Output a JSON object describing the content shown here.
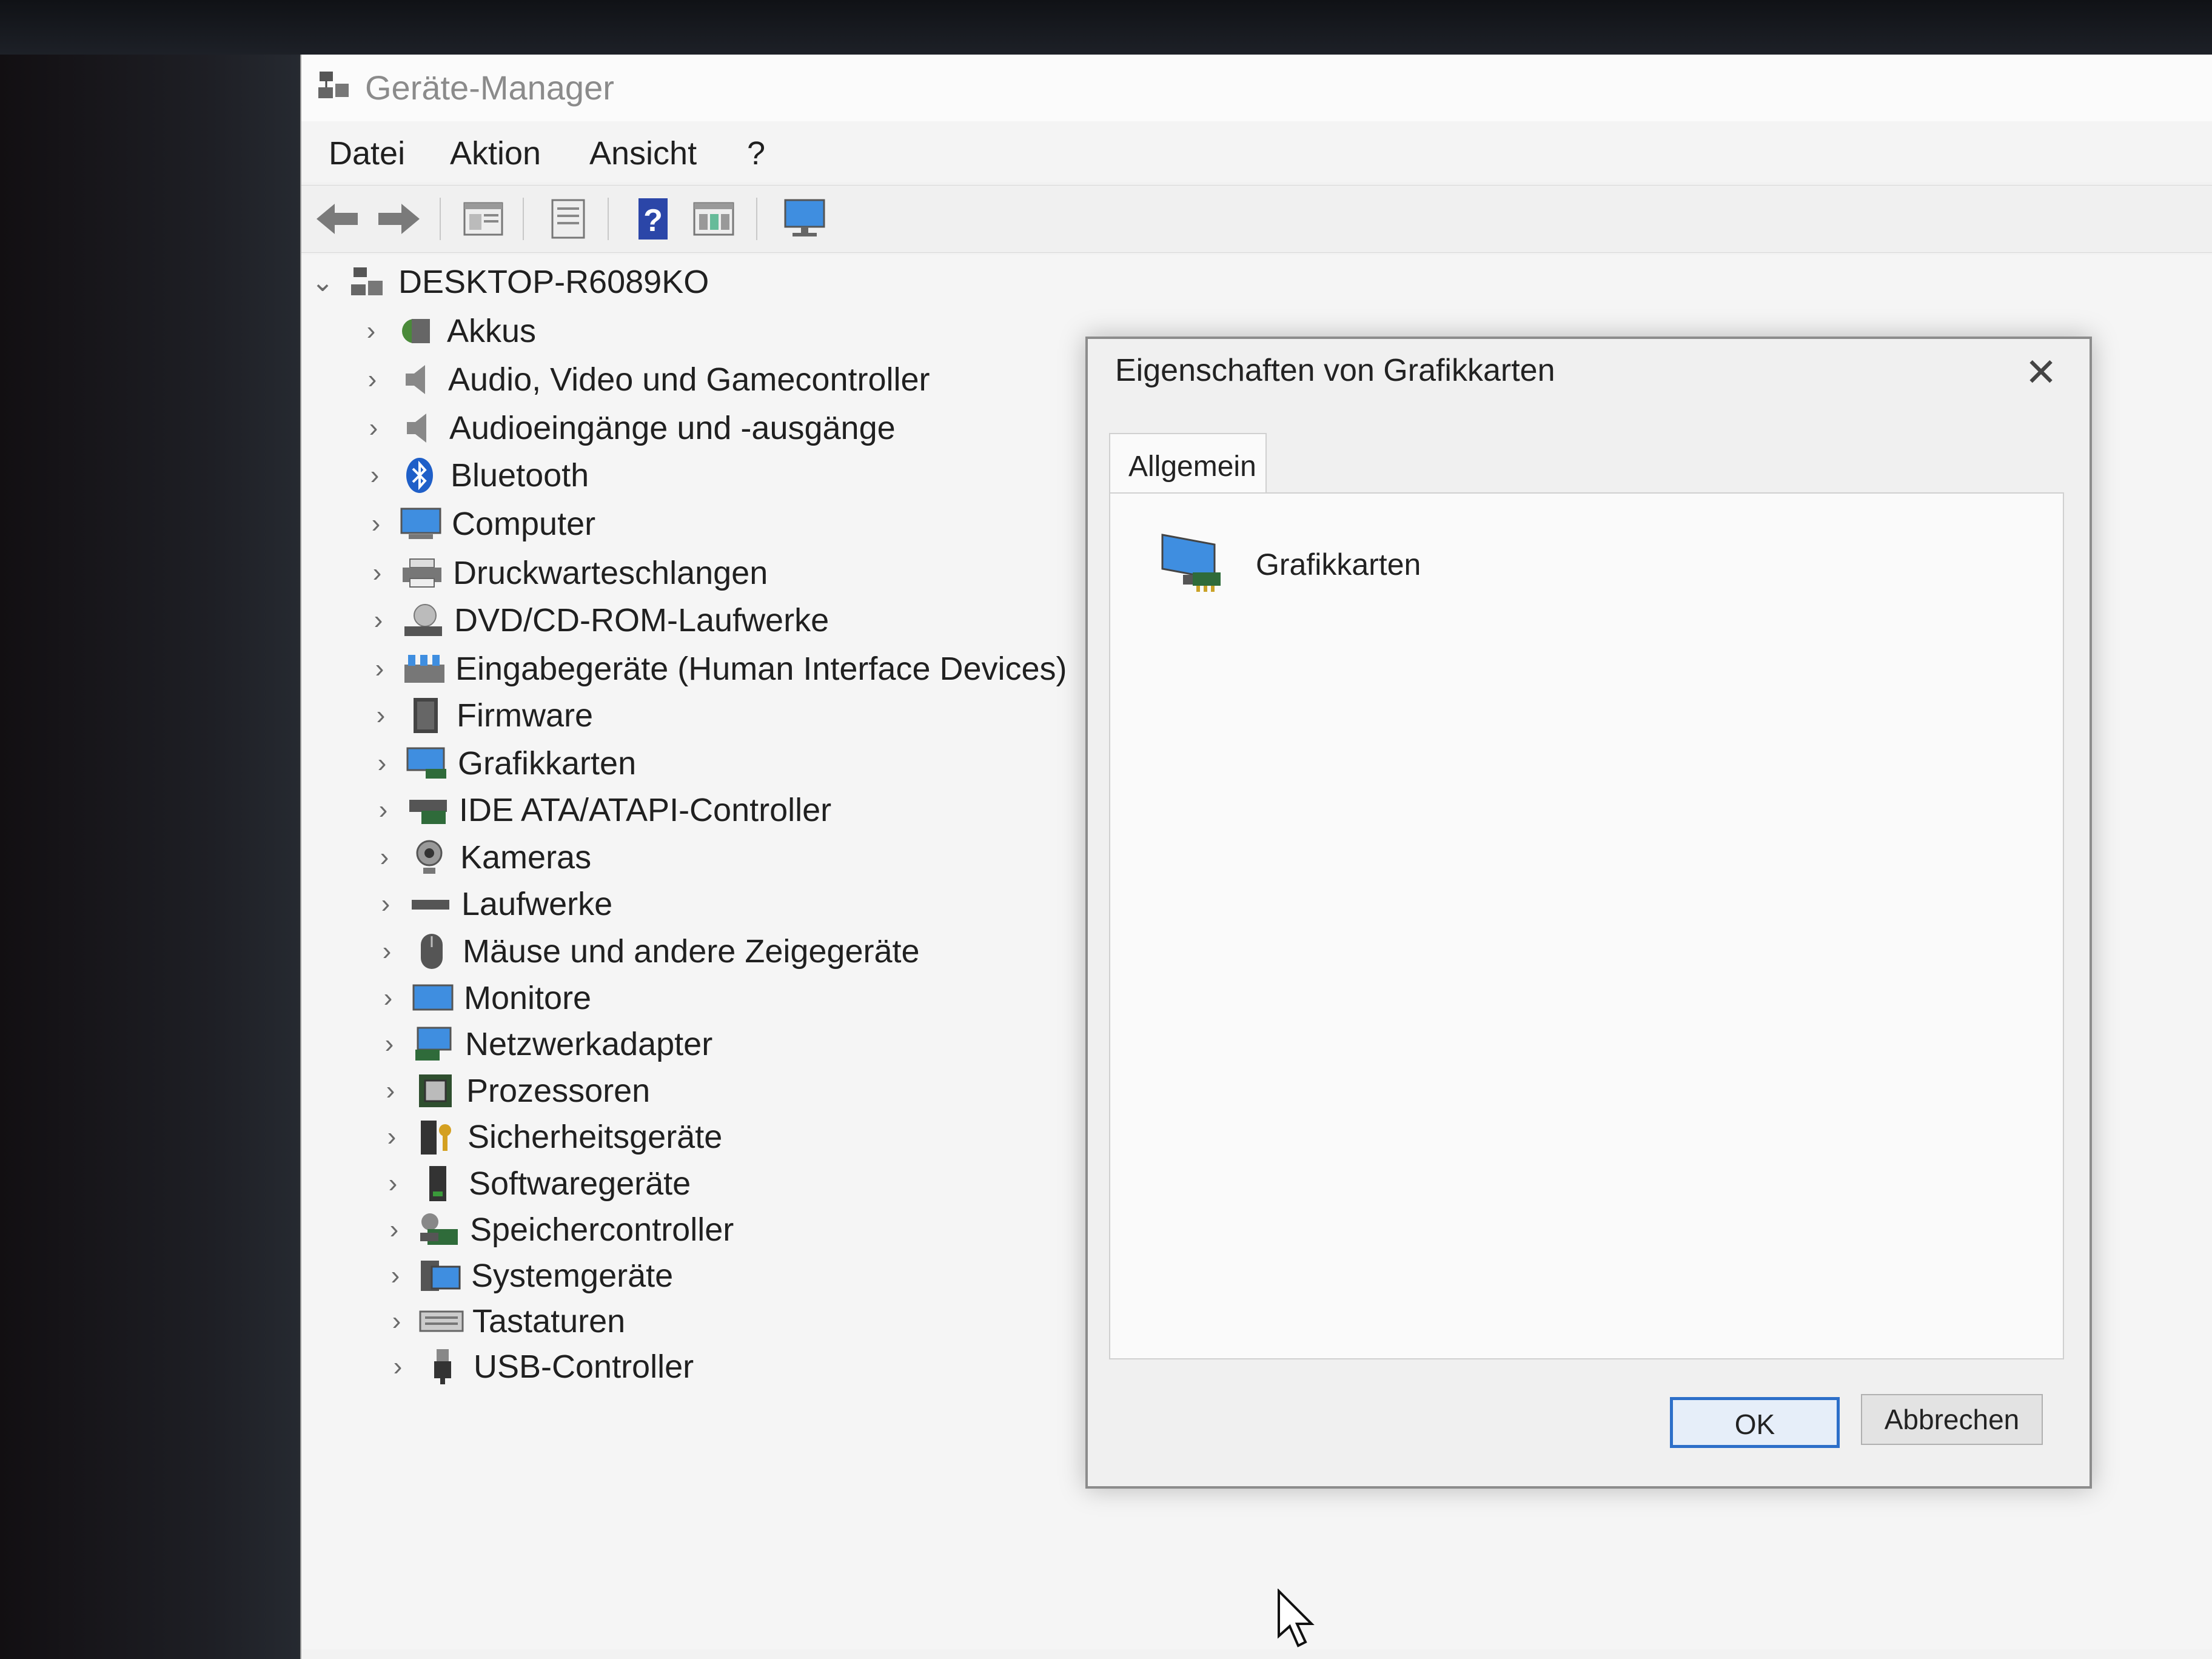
{
  "window": {
    "title": "Geräte-Manager",
    "icon": "device-manager-icon"
  },
  "menu": [
    "Datei",
    "Aktion",
    "Ansicht",
    "?"
  ],
  "toolbar": {
    "buttons": [
      "back-icon",
      "forward-icon",
      "properties-sheet-icon",
      "update-driver-icon",
      "help-icon",
      "details-view-icon",
      "monitor-icon"
    ]
  },
  "tree": {
    "root": "DESKTOP-R6089KO",
    "items": [
      "Akkus",
      "Audio, Video und Gamecontroller",
      "Audioeingänge und -ausgänge",
      "Bluetooth",
      "Computer",
      "Druckwarteschlangen",
      "DVD/CD-ROM-Laufwerke",
      "Eingabegeräte (Human Interface Devices)",
      "Firmware",
      "Grafikkarten",
      "IDE ATA/ATAPI-Controller",
      "Kameras",
      "Laufwerke",
      "Mäuse und andere Zeigegeräte",
      "Monitore",
      "Netzwerkadapter",
      "Prozessoren",
      "Sicherheitsgeräte",
      "Softwaregeräte",
      "Speichercontroller",
      "Systemgeräte",
      "Tastaturen",
      "USB-Controller"
    ]
  },
  "dialog": {
    "title": "Eigenschaften von Grafikkarten",
    "tab": "Allgemein",
    "device_name": "Grafikkarten",
    "ok_label": "OK",
    "cancel_label": "Abbrechen",
    "close_glyph": "✕"
  },
  "colors": {
    "accent": "#2d6fc9",
    "tree_bg": "#f5f5f5",
    "dialog_bg": "#f0f0f0"
  }
}
